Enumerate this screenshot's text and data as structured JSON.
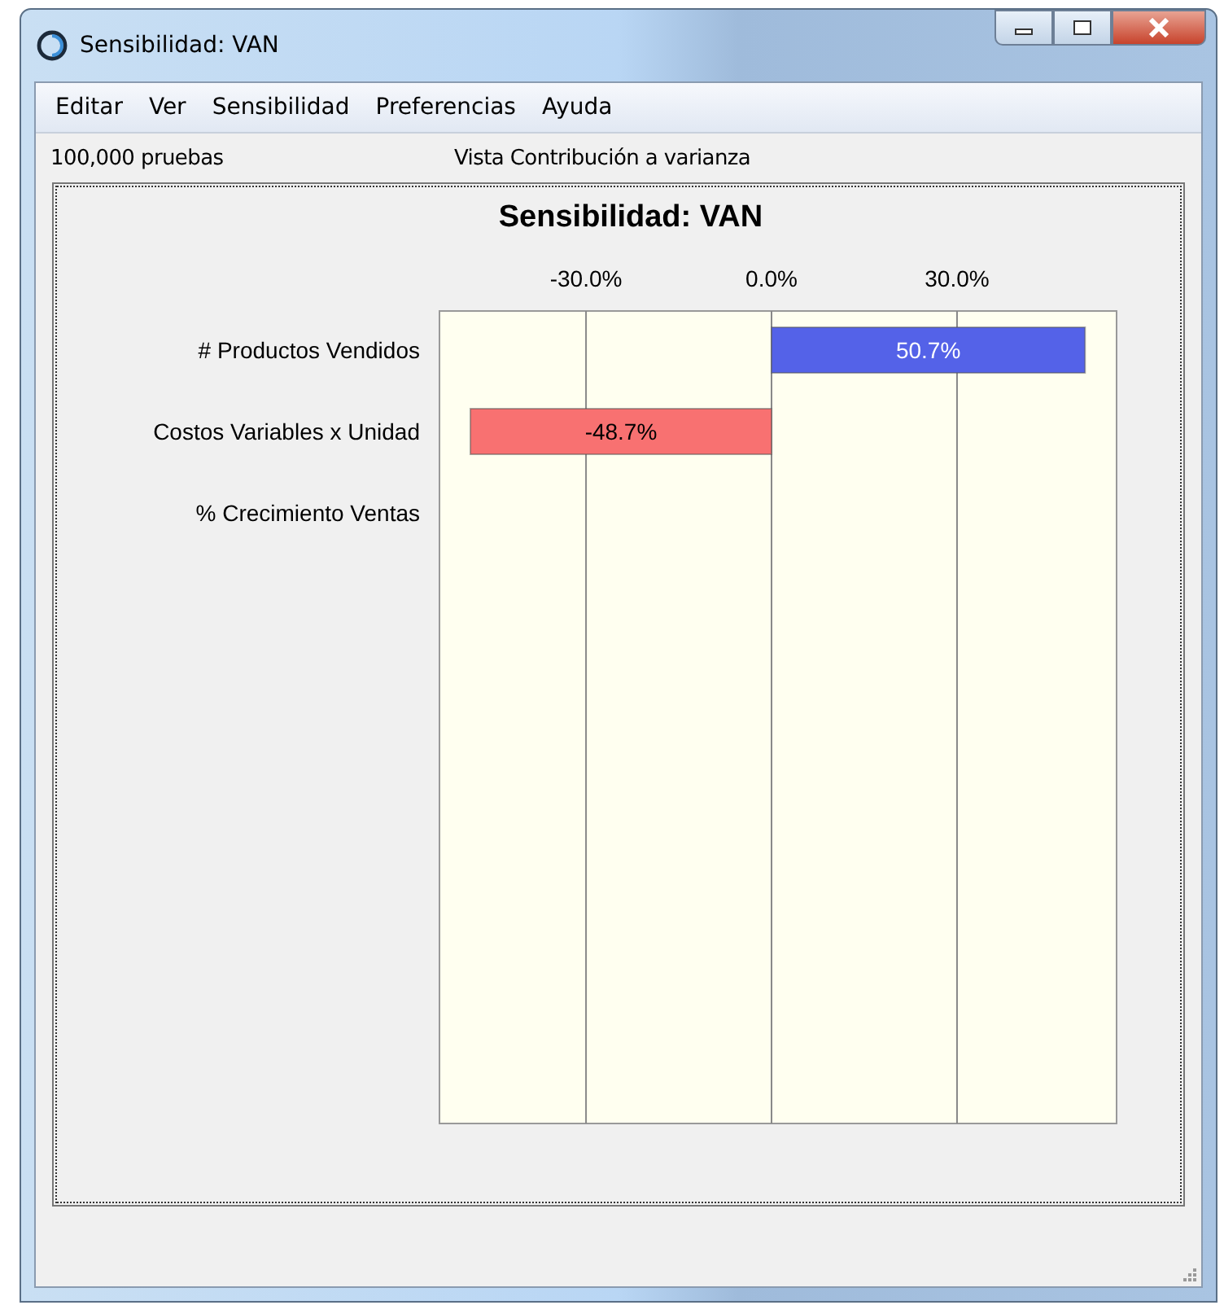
{
  "window": {
    "title": "Sensibilidad: VAN"
  },
  "menu": [
    "Editar",
    "Ver",
    "Sensibilidad",
    "Preferencias",
    "Ayuda"
  ],
  "info": {
    "trials": "100,000 pruebas",
    "view": "Vista Contribución a varianza"
  },
  "chart": {
    "chart_data": {
      "type": "bar",
      "orientation": "horizontal",
      "title": "Sensibilidad: VAN",
      "categories": [
        "# Productos Vendidos",
        "Costos Variables x Unidad",
        "% Crecimiento Ventas"
      ],
      "series": [
        {
          "color": "#5462e8",
          "values": [
            50.7,
            null,
            0
          ]
        },
        {
          "color": "#f87171",
          "values": [
            null,
            -48.7,
            null
          ]
        }
      ],
      "grid": true,
      "value_labels": [
        "50.7%",
        "-48.7%",
        null
      ],
      "xlim": [
        -53.7,
        55.8
      ],
      "xticks": [
        {
          "value": -30,
          "label": "-30.0%"
        },
        {
          "value": 0,
          "label": "0.0%"
        },
        {
          "value": 30,
          "label": "30.0%"
        }
      ]
    }
  }
}
